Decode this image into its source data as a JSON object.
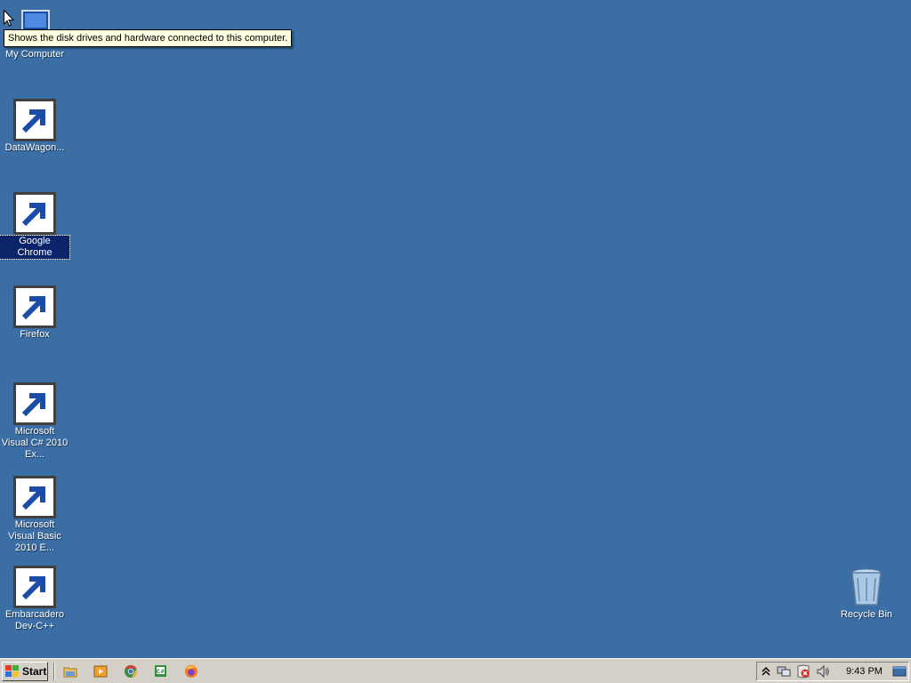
{
  "desktop": {
    "background_color": "#3a6ea5",
    "icons": [
      {
        "label": "My Computer",
        "icon": "my-computer-icon"
      },
      {
        "label": "DataWagon...",
        "icon": "datawagon-icon"
      },
      {
        "label": "Google Chrome",
        "icon": "chrome-icon",
        "selected": true
      },
      {
        "label": "Firefox",
        "icon": "firefox-icon"
      },
      {
        "label": "Microsoft Visual C# 2010 Ex...",
        "icon": "visual-csharp-icon"
      },
      {
        "label": "Microsoft Visual Basic 2010 E...",
        "icon": "visual-basic-icon"
      },
      {
        "label": "Embarcadero Dev-C++",
        "icon": "devcpp-icon"
      },
      {
        "label": "Recycle Bin",
        "icon": "recycle-bin-icon"
      }
    ]
  },
  "tooltip": {
    "text": "Shows the disk drives and hardware connected to this computer."
  },
  "taskbar": {
    "start_label": "Start",
    "quick_launch": [
      "file-explorer-icon",
      "media-player-icon",
      "chrome-icon",
      "visual-csharp-icon",
      "firefox-icon"
    ],
    "tray_icons": [
      "show-hidden-icons-icon",
      "network-icon",
      "action-center-icon",
      "volume-icon"
    ],
    "clock": "9:43 PM"
  }
}
